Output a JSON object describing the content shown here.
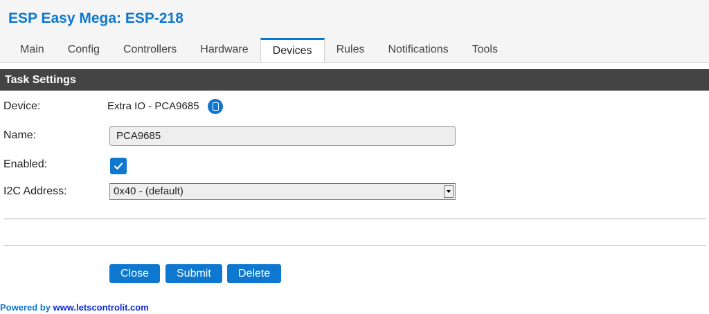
{
  "app": {
    "title": "ESP Easy Mega: ESP-218"
  },
  "tabs": [
    {
      "label": "Main"
    },
    {
      "label": "Config"
    },
    {
      "label": "Controllers"
    },
    {
      "label": "Hardware"
    },
    {
      "label": "Devices",
      "active": true
    },
    {
      "label": "Rules"
    },
    {
      "label": "Notifications"
    },
    {
      "label": "Tools"
    }
  ],
  "section": {
    "title": "Task Settings"
  },
  "form": {
    "device_label": "Device:",
    "device_value": "Extra IO - PCA9685",
    "name_label": "Name:",
    "name_value": "PCA9685",
    "enabled_label": "Enabled:",
    "enabled": true,
    "i2c_label": "I2C Address:",
    "i2c_value": "0x40 - (default)"
  },
  "buttons": {
    "close": "Close",
    "submit": "Submit",
    "delete": "Delete"
  },
  "footer": {
    "prefix": "Powered by ",
    "link": "www.letscontrolit.com"
  },
  "colors": {
    "accent": "#0e77cf",
    "section_bar": "#444444",
    "footer_link": "#0b2bd8"
  },
  "icons": {
    "device_info": "info-icon",
    "checkbox": "checkmark-icon",
    "select_arrow": "chevron-down-icon"
  }
}
